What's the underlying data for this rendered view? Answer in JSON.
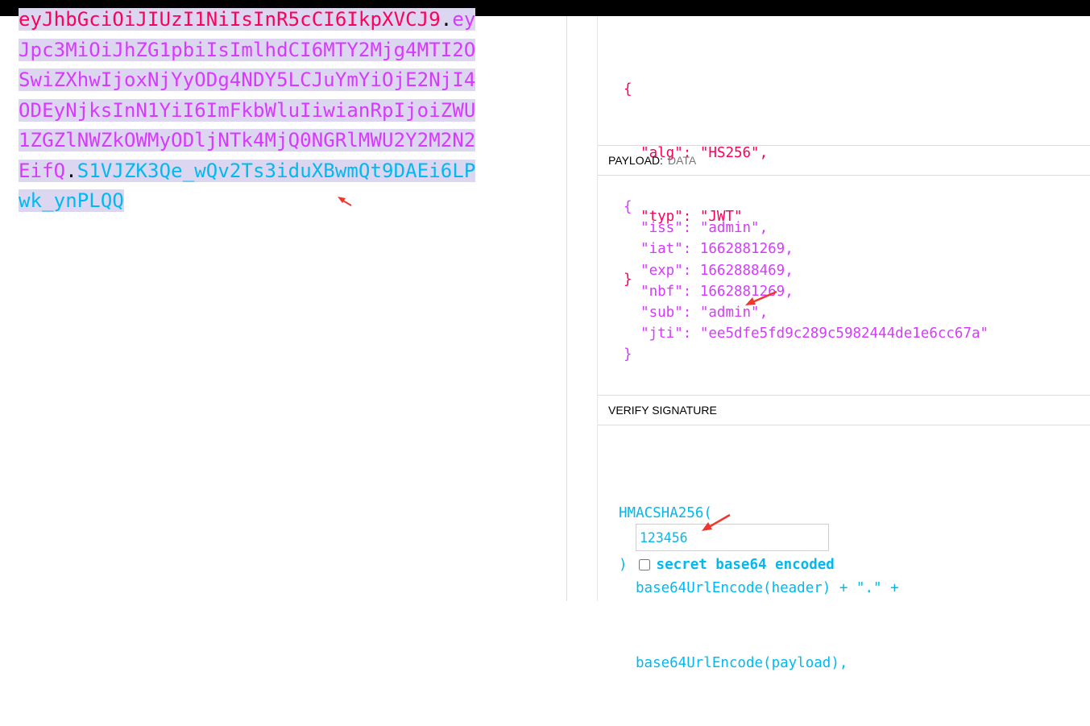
{
  "encoded_token": {
    "lines": [
      [
        {
          "text": "eyJhbGciOiJIUzI1NiIsInR5cCI6IkpXVCJ9",
          "part": "header"
        },
        {
          "text": ".",
          "part": "dot"
        },
        {
          "text": "ey",
          "part": "payload"
        }
      ],
      [
        {
          "text": "Jpc3MiOiJhZG1pbiIsImlhdCI6MTY2Mjg4MTI2O",
          "part": "payload"
        }
      ],
      [
        {
          "text": "SwiZXhwIjoxNjYyODg4NDY5LCJuYmYiOjE2NjI4",
          "part": "payload"
        }
      ],
      [
        {
          "text": "ODEyNjksInN1YiI6ImFkbWluIiwianRpIjoiZWU",
          "part": "payload"
        }
      ],
      [
        {
          "text": "1ZGZlNWZkOWMyODljNTk4MjQ0NGRlMWU2Y2M2N2",
          "part": "payload"
        }
      ],
      [
        {
          "text": "EifQ",
          "part": "payload"
        },
        {
          "text": ".",
          "part": "dot"
        },
        {
          "text": "S1VJZK3Qe_wQv2Ts3iduXBwmQt9DAEi6LP",
          "part": "sig"
        }
      ],
      [
        {
          "text": "wk_ynPLQQ",
          "part": "sig"
        }
      ]
    ]
  },
  "header_json": {
    "open": "{",
    "alg_key": "\"alg\"",
    "alg_val": "\"HS256\"",
    "typ_key": "\"typ\"",
    "typ_val": "\"JWT\"",
    "close": "}"
  },
  "payload_section": {
    "label": "PAYLOAD:",
    "sublabel": "DATA"
  },
  "payload_json": {
    "open": "{",
    "entries": [
      {
        "key": "\"iss\"",
        "val": "\"admin\""
      },
      {
        "key": "\"iat\"",
        "val": "1662881269"
      },
      {
        "key": "\"exp\"",
        "val": "1662888469"
      },
      {
        "key": "\"nbf\"",
        "val": "1662881269"
      },
      {
        "key": "\"sub\"",
        "val": "\"admin\""
      },
      {
        "key": "\"jti\"",
        "val": "\"ee5dfe5fd9c289c5982444de1e6cc67a\""
      }
    ],
    "close": "}"
  },
  "verify_section": {
    "label": "VERIFY SIGNATURE",
    "line1": "HMACSHA256(",
    "line2": "base64UrlEncode(header) + \".\" +",
    "line3": "base64UrlEncode(payload),",
    "secret_value": "123456",
    "closing": ")",
    "checkbox_label": "secret base64 encoded"
  },
  "colors": {
    "header": "#fb015b",
    "payload": "#d63aff",
    "signature": "#00b9f1",
    "selection": "#dcd6f0",
    "annotation_arrow": "#f0362d"
  }
}
